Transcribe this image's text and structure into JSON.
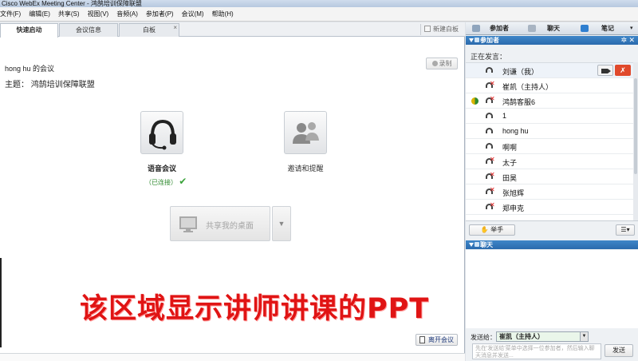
{
  "window": {
    "title": "Cisco WebEx Meeting Center - 鸿鹄培训保障联盟"
  },
  "menu": [
    "文件(F)",
    "编辑(E)",
    "共享(S)",
    "视图(V)",
    "音频(A)",
    "参加者(P)",
    "会议(M)",
    "帮助(H)"
  ],
  "left": {
    "tabs": [
      {
        "label": "快速启动"
      },
      {
        "label": "会议信息"
      },
      {
        "label": "白板"
      }
    ],
    "new_whiteboard": "新建白板",
    "meeting_name": "hong hu 的会议",
    "topic_label": "主题：",
    "topic_value": "鸿鹄培训保障联盟",
    "record": "录制",
    "audio_label": "语音会议",
    "audio_status": "（已连接）",
    "invite_label": "邀请和提醒",
    "share_desktop": "共享我的桌面",
    "annotation": "该区域显示讲师讲课的PPT",
    "leave": "离开会议"
  },
  "right": {
    "tabs": {
      "participants": "参加者",
      "chat": "聊天",
      "notes": "笔记"
    },
    "participants_panel": "参加者",
    "speaking_label": "正在发言：",
    "participants": [
      {
        "name": "刘谦（我）"
      },
      {
        "name": "崔凯（主持人）"
      },
      {
        "name": "鸿鹄客服6"
      },
      {
        "name": "1"
      },
      {
        "name": "hong hu"
      },
      {
        "name": "啊啊"
      },
      {
        "name": "太子"
      },
      {
        "name": "田昊"
      },
      {
        "name": "张旭辉"
      },
      {
        "name": "郑申克"
      }
    ],
    "raise_hand": "举手",
    "chat_panel": "聊天",
    "send_to_label": "发送给：",
    "send_to_value": "崔凯（主持人）",
    "chat_placeholder": "先在'发送给'菜单中选择一位参加者，然后输入聊天消息并发送...",
    "send": "发送"
  }
}
